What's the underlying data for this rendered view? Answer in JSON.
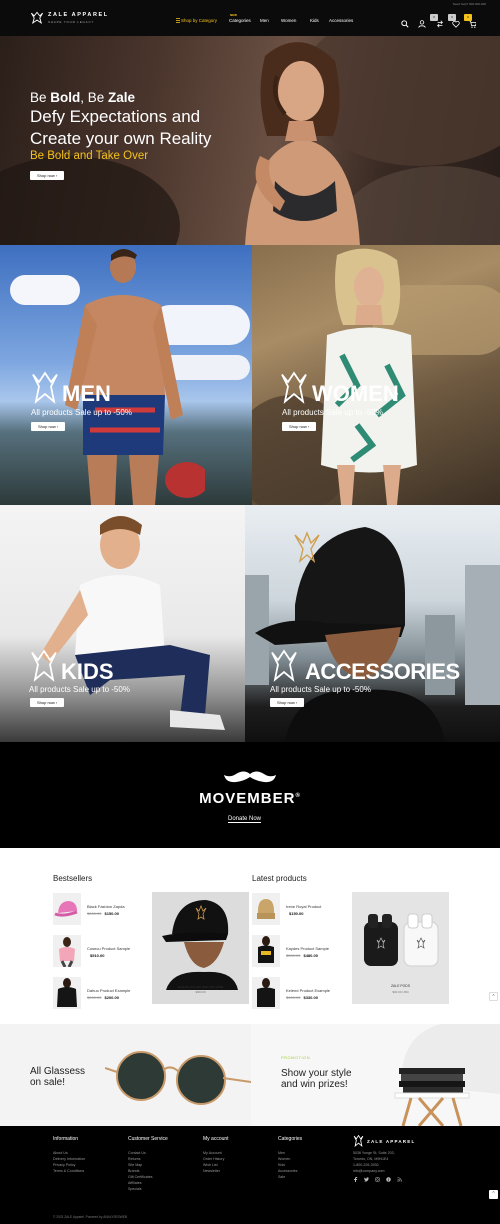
{
  "header": {
    "brand": "ZALE APPAREL",
    "tagline": "SHAPE YOUR LEGACY",
    "phone": "Need help? 000-000-000",
    "nav_shop": "Shop by Category",
    "nav_new": "NEW",
    "nav_categories": "Categories",
    "nav_men": "Men",
    "nav_women": "Women",
    "nav_kids": "Kids",
    "nav_accessories": "Accessories",
    "compare_count": "0",
    "wishlist_count": "0",
    "cart_count": "0"
  },
  "hero": {
    "line1_a": "Be ",
    "line1_b": "Bold",
    "line1_c": ", Be ",
    "line1_d": "Zale",
    "line2": "Defy Expectations and",
    "line3": "Create your own Reality",
    "line4": "Be Bold and Take Over",
    "button": "Shop now"
  },
  "tiles": [
    {
      "title": "MEN",
      "sub": "All products Sale up to -50%",
      "button": "Shop now"
    },
    {
      "title": "WOMEN",
      "sub": "All products Sale up to -50%",
      "button": "Shop now"
    },
    {
      "title": "KIDS",
      "sub": "All products Sale up to -50%",
      "button": "Shop now"
    },
    {
      "title": "ACCESSORIES",
      "sub": "All products Sale up to -50%",
      "button": "Shop now"
    }
  ],
  "movember": {
    "title": "MOVEMBER",
    "reg": "®",
    "donate": "Donate Now"
  },
  "bestsellers": {
    "title": "Bestsellers",
    "items": [
      {
        "name": "Black Fashion Zapda",
        "old": "$000.00",
        "price": "$150.00"
      },
      {
        "name": "Cosecu Product Sample",
        "old": "",
        "price": "$510.00"
      },
      {
        "name": "Dahuo Product Example",
        "old": "$000.00",
        "price": "$200.00"
      }
    ]
  },
  "latest": {
    "title": "Latest products",
    "items": [
      {
        "name": "Irene Royal Product",
        "old": "",
        "price": "$150.00"
      },
      {
        "name": "Kaydes Product Sample",
        "old": "$500.00",
        "price": "$480.00"
      },
      {
        "name": "Kelend Product Example",
        "old": "$400.00",
        "price": "$330.00"
      }
    ]
  },
  "featured_left": {
    "caption": "ZALE BLACK AND RED CAP SOME",
    "price": "$000.00"
  },
  "featured_right": {
    "caption": "ZALE PODS",
    "price": "$00.00 USD"
  },
  "promo_left": {
    "line1": "All Glassess",
    "line2": "on sale!"
  },
  "promo_right": {
    "kicker": "PROMOTION",
    "line1": "Show your style",
    "line2": "and win prizes!"
  },
  "footer": {
    "info": {
      "title": "Information",
      "links": [
        "About Us",
        "Delivery Information",
        "Privacy Policy",
        "Terms & Conditions"
      ]
    },
    "service": {
      "title": "Customer Service",
      "links": [
        "Contact Us",
        "Returns",
        "Site Map",
        "Brands",
        "Gift Certificates",
        "Affiliates",
        "Specials"
      ]
    },
    "account": {
      "title": "My account",
      "links": [
        "My Account",
        "Order History",
        "Wish List",
        "Newsletter"
      ]
    },
    "categories": {
      "title": "Categories",
      "links": [
        "Men",
        "Women",
        "Kids",
        "Accessories",
        "Sale"
      ]
    },
    "brand": "ZALE APPAREL",
    "address": [
      "5036 Yonge St, Suite 203,",
      "Toronto, ON, M9N1E4",
      "1-800-226-3930",
      "info@company.com"
    ],
    "copyright": "© 2023 ZALE Apparel. Powered by ANALYSESWEB"
  },
  "colors": {
    "accent": "#f4c21b",
    "dark": "#0b0b0b"
  }
}
